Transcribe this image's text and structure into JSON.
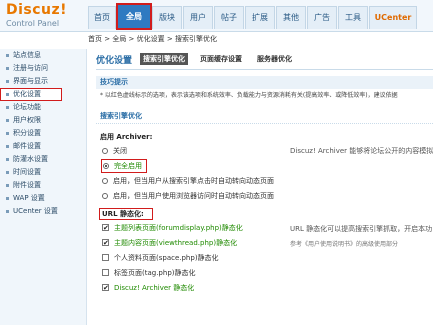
{
  "logo": {
    "title": "Discuz!",
    "subtitle": "Control Panel"
  },
  "nav": {
    "tabs": [
      {
        "label": "首页",
        "name": "tab-home"
      },
      {
        "label": "全局",
        "name": "tab-global",
        "active": true
      },
      {
        "label": "版块",
        "name": "tab-forums"
      },
      {
        "label": "用户",
        "name": "tab-users"
      },
      {
        "label": "帖子",
        "name": "tab-posts"
      },
      {
        "label": "扩展",
        "name": "tab-extend"
      },
      {
        "label": "其他",
        "name": "tab-other"
      },
      {
        "label": "广告",
        "name": "tab-ads"
      },
      {
        "label": "工具",
        "name": "tab-tools"
      },
      {
        "label": "UCenter",
        "name": "tab-ucenter"
      }
    ]
  },
  "breadcrumb": "首页 > 全局 > 优化设置 > 搜索引擎优化",
  "sidebar": {
    "items": [
      {
        "label": "站点信息"
      },
      {
        "label": "注册与访问"
      },
      {
        "label": "界面与显示"
      },
      {
        "label": "优化设置",
        "active": true
      },
      {
        "label": "论坛功能"
      },
      {
        "label": "用户权限"
      },
      {
        "label": "积分设置"
      },
      {
        "label": "邮件设置"
      },
      {
        "label": "防灌水设置"
      },
      {
        "label": "时间设置"
      },
      {
        "label": "附件设置"
      },
      {
        "label": "WAP 设置"
      },
      {
        "label": "UCenter 设置"
      }
    ]
  },
  "main": {
    "title": "优化设置",
    "subtabs": [
      {
        "label": "搜索引擎优化",
        "active": true
      },
      {
        "label": "页面缓存设置"
      },
      {
        "label": "服务器优化"
      }
    ],
    "tips_heading": "技巧提示",
    "tip_text": "* 以红色虚线标示的选项，表示该选项和系统效率、负载能力与资源消耗有关(提高效率、或降低效率)，建议依据",
    "seo_heading": "搜索引擎优化",
    "archiver": {
      "label": "启用 Archiver:",
      "options": [
        {
          "label": "关闭"
        },
        {
          "label": "完全启用",
          "selected": true
        },
        {
          "label": "启用，但当用户从搜索引擎点击时自动转向动态页面"
        },
        {
          "label": "启用，但当用户使用浏览器访问时自动转向动态页面"
        }
      ],
      "description": "Discuz! Archiver 能够将论坛公开的内容模拟"
    },
    "url": {
      "label": "URL 静态化:",
      "options": [
        {
          "label": "主题列表页面(forumdisplay.php)静态化",
          "checked": true
        },
        {
          "label": "主题内容页面(viewthread.php)静态化",
          "checked": true
        },
        {
          "label": "个人资料页面(space.php)静态化",
          "checked": false
        },
        {
          "label": "标签页面(tag.php)静态化",
          "checked": false
        },
        {
          "label": "Discuz! Archiver 静态化",
          "checked": true
        }
      ],
      "description_line1": "URL 静态化可以提高搜索引擎抓取，开启本功",
      "description_line2": "参考《用户使用说明书》的高级使用部分"
    }
  }
}
